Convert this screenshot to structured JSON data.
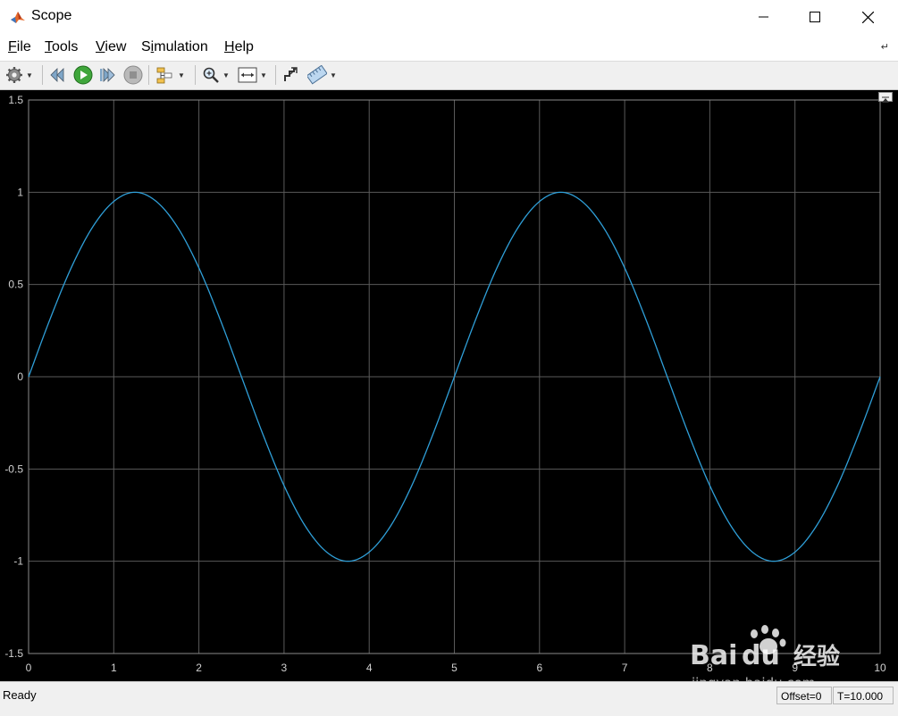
{
  "window": {
    "title": "Scope",
    "icon": "matlab-peaks-icon"
  },
  "menu": [
    {
      "label": "File",
      "mnemonic": "F"
    },
    {
      "label": "Tools",
      "mnemonic": "T"
    },
    {
      "label": "View",
      "mnemonic": "V"
    },
    {
      "label": "Simulation",
      "mnemonic": "i"
    },
    {
      "label": "Help",
      "mnemonic": "H"
    }
  ],
  "toolbar": {
    "icons": [
      "gear-icon",
      "step-back-icon",
      "run-icon",
      "step-forward-icon",
      "stop-icon",
      "signal-selector-icon",
      "zoom-icon",
      "autoscale-icon",
      "write-data-icon",
      "measure-icon"
    ]
  },
  "chart_data": {
    "type": "line",
    "title": "",
    "xlabel": "",
    "ylabel": "",
    "xlim": [
      0,
      10
    ],
    "ylim": [
      -1.5,
      1.5
    ],
    "xticks": [
      0,
      1,
      2,
      3,
      4,
      5,
      6,
      7,
      8,
      9,
      10
    ],
    "xtick_labels": [
      "0",
      "1",
      "2",
      "3",
      "4",
      "5",
      "6",
      "7",
      "8",
      "9",
      "10"
    ],
    "yticks": [
      1.5,
      1,
      0.5,
      0,
      -0.5,
      -1,
      -1.5
    ],
    "ytick_labels": [
      "1.5",
      "1",
      "0.5",
      "0",
      "-0.5",
      "-1",
      "-1.5"
    ],
    "grid": true,
    "background": "#000000",
    "gridColor": "#5a5a5a",
    "tickColor": "#d0d0d0",
    "series": [
      {
        "color": "#2f9fd8",
        "x": [
          0,
          0.25,
          0.5,
          0.75,
          1,
          1.25,
          1.5,
          1.75,
          2,
          2.25,
          2.5,
          2.75,
          3,
          3.25,
          3.5,
          3.75,
          4,
          4.25,
          4.5,
          4.75,
          5,
          5.25,
          5.5,
          5.75,
          6,
          6.25,
          6.5,
          6.75,
          7,
          7.25,
          7.5,
          7.75,
          8,
          8.25,
          8.5,
          8.75,
          9,
          9.25,
          9.5,
          9.75,
          10
        ],
        "values": [
          0,
          0.31,
          0.59,
          0.81,
          0.95,
          1,
          0.95,
          0.81,
          0.59,
          0.31,
          0,
          -0.31,
          -0.59,
          -0.81,
          -0.95,
          -1,
          -0.95,
          -0.81,
          -0.59,
          -0.31,
          0,
          0.31,
          0.59,
          0.81,
          0.95,
          1,
          0.95,
          0.81,
          0.59,
          0.31,
          0,
          -0.31,
          -0.59,
          -0.81,
          -0.95,
          -1,
          -0.95,
          -0.81,
          -0.59,
          -0.31,
          0
        ]
      }
    ]
  },
  "status": {
    "text": "Ready",
    "offset": "Offset=0",
    "time": "T=10.000"
  },
  "watermark": {
    "brand": "Bai",
    "brand2": "du",
    "cn": "经验",
    "url": "jingyan.baidu.com"
  }
}
